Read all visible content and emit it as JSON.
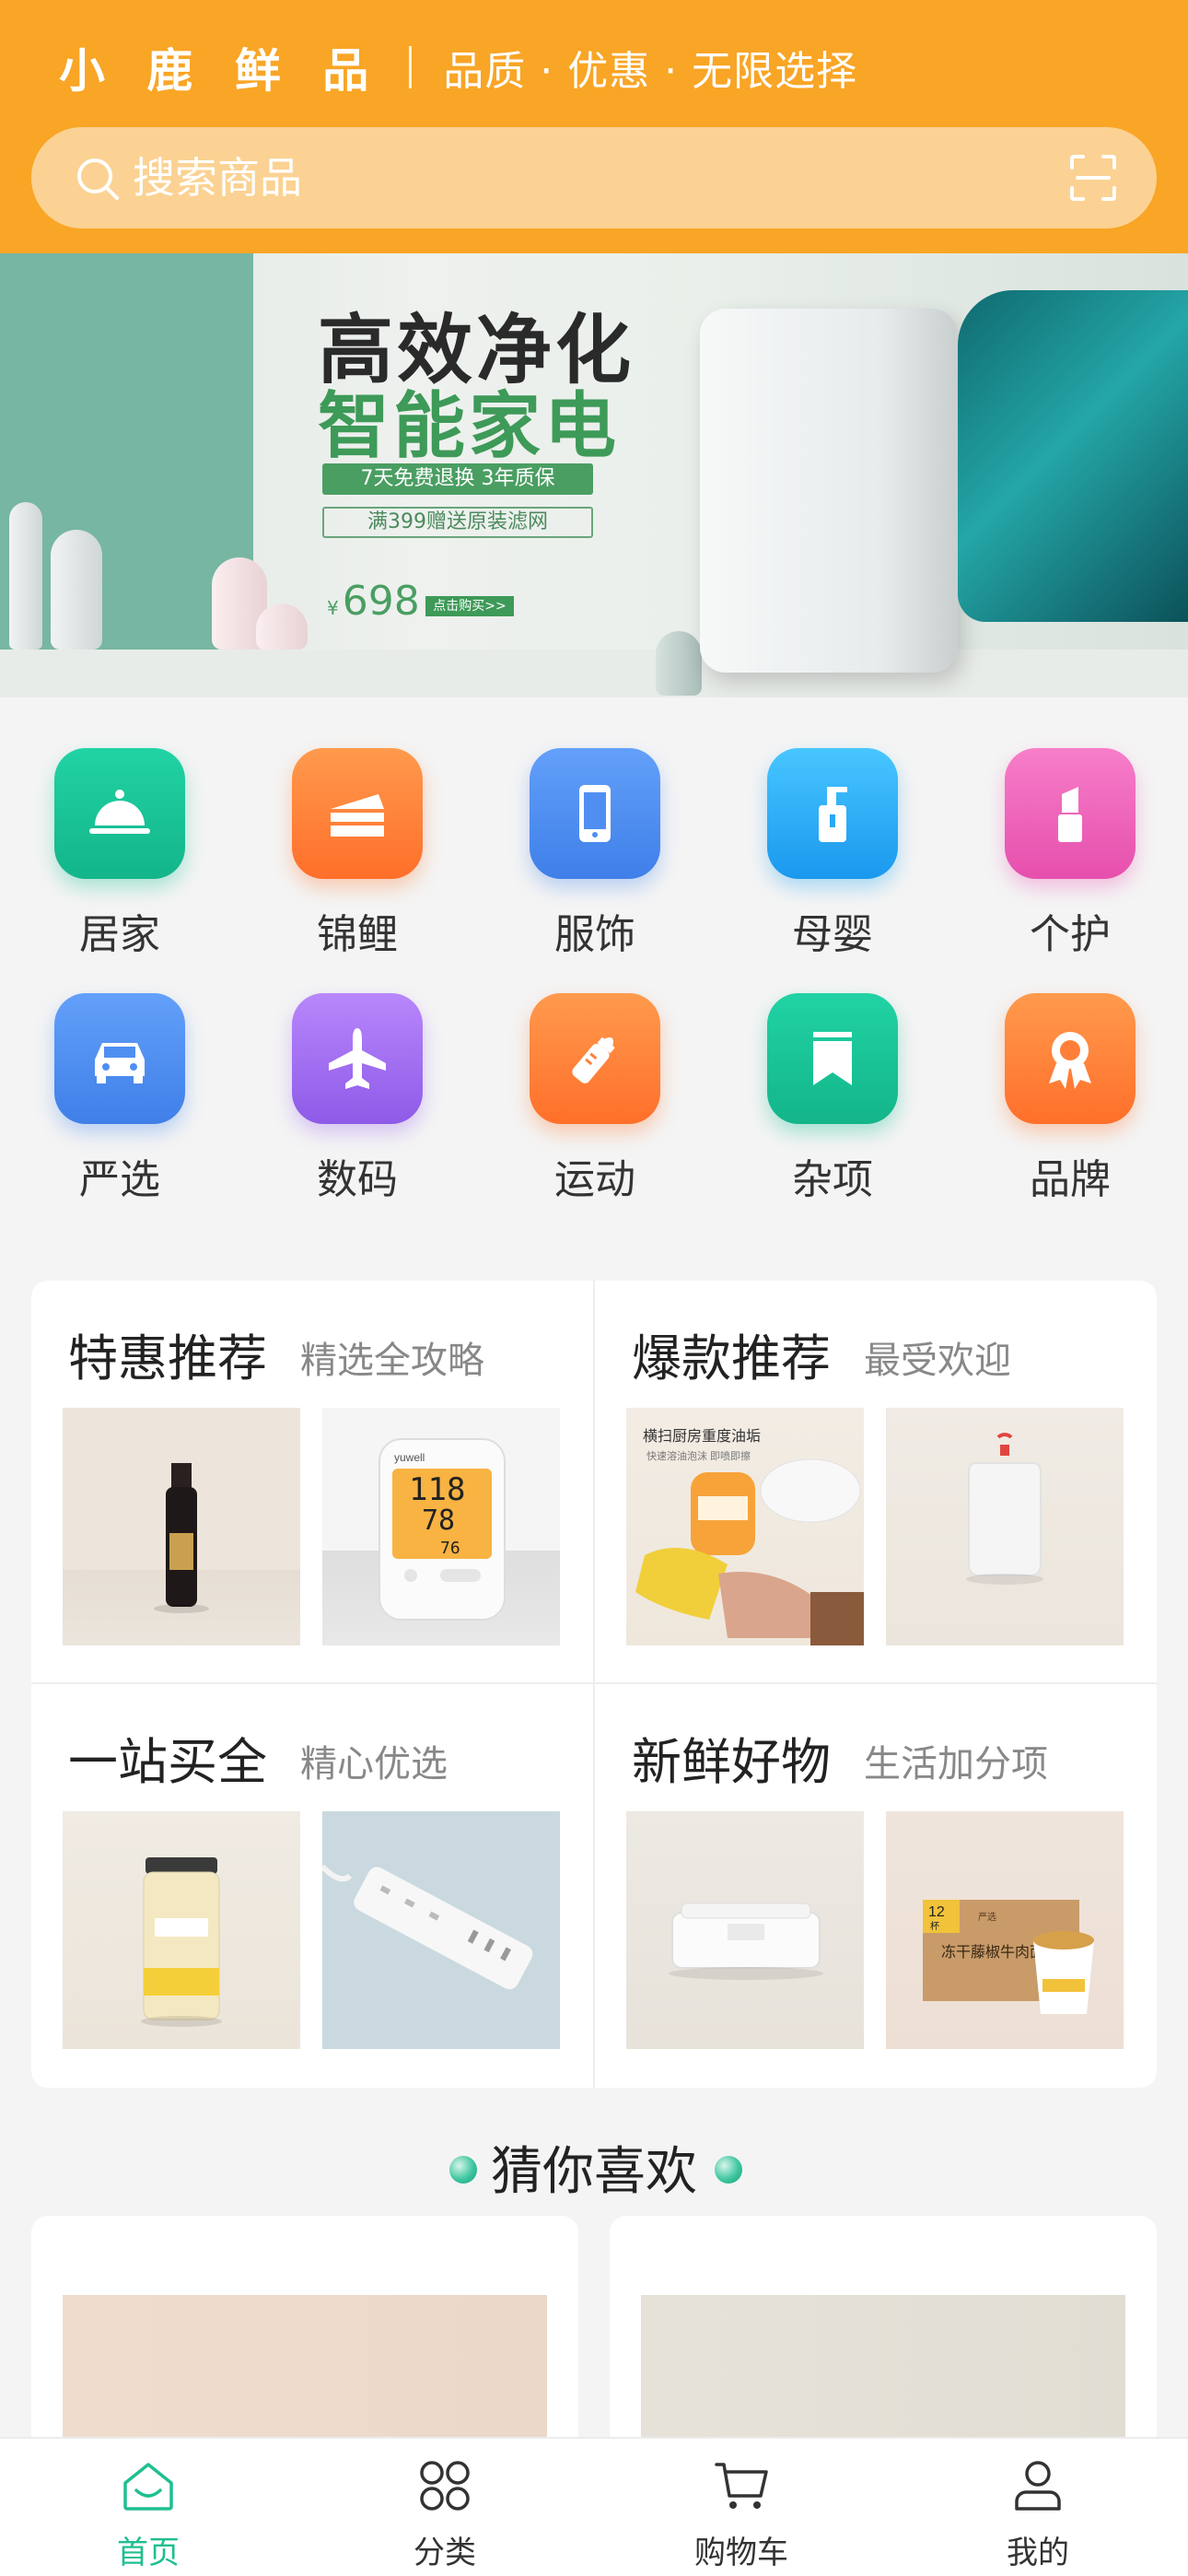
{
  "header": {
    "brand": "小 鹿 鲜 品",
    "slogan": "品质 · 优惠 · 无限选择",
    "bg_color": "#f9a526"
  },
  "search": {
    "placeholder": "搜索商品",
    "icon": "search-icon",
    "scan_icon": "scan-icon"
  },
  "banner": {
    "title_line1": "高效净化",
    "title_line2": "智能家电",
    "tag1": "7天免费退换 3年质保",
    "tag2": "满399赠送原装滤网",
    "price_symbol": "¥",
    "price": "698",
    "buy_label": "点击购买>>",
    "active_slide": 1,
    "slide_count": 4
  },
  "categories": [
    {
      "label": "居家",
      "icon": "cloche-icon",
      "color": "#1fc79a"
    },
    {
      "label": "锦鲤",
      "icon": "cake-icon",
      "color": "#ff7f3a"
    },
    {
      "label": "服饰",
      "icon": "phone-icon",
      "color": "#4f8ff2"
    },
    {
      "label": "母婴",
      "icon": "bottle-icon",
      "color": "#27aaf3"
    },
    {
      "label": "个护",
      "icon": "lipstick-icon",
      "color": "#ef5fb8"
    },
    {
      "label": "严选",
      "icon": "car-icon",
      "color": "#4f8ff2"
    },
    {
      "label": "数码",
      "icon": "plane-icon",
      "color": "#a06cf2"
    },
    {
      "label": "运动",
      "icon": "baby-bottle-icon",
      "color": "#ff7f3a"
    },
    {
      "label": "杂项",
      "icon": "bookmark-icon",
      "color": "#18c198"
    },
    {
      "label": "品牌",
      "icon": "ribbon-icon",
      "color": "#ff7f3a"
    }
  ],
  "promo": [
    {
      "title": "特惠推荐",
      "subtitle": "精选全攻略"
    },
    {
      "title": "爆款推荐",
      "subtitle": "最受欢迎"
    },
    {
      "title": "一站买全",
      "subtitle": "精心优选"
    },
    {
      "title": "新鲜好物",
      "subtitle": "生活加分项"
    }
  ],
  "product_texts": {
    "cleaner_line1": "横扫厨房重度油垢",
    "cleaner_line2": "快速溶油泡沫 即喷即擦",
    "monitor_brand": "yuwell",
    "monitor_value1": "118",
    "monitor_value2": "78",
    "monitor_value3": "76",
    "noodle_count": "12",
    "noodle_unit": "杯",
    "noodle_label": "冻干藤椒牛肉面",
    "noodle_brand": "严选"
  },
  "guess": {
    "title": "猜你喜欢"
  },
  "tabbar": [
    {
      "label": "首页",
      "icon": "home-icon",
      "active": true
    },
    {
      "label": "分类",
      "icon": "category-icon",
      "active": false
    },
    {
      "label": "购物车",
      "icon": "cart-icon",
      "active": false
    },
    {
      "label": "我的",
      "icon": "user-icon",
      "active": false
    }
  ],
  "colors": {
    "accent": "#1fbf91",
    "header": "#f9a526"
  }
}
